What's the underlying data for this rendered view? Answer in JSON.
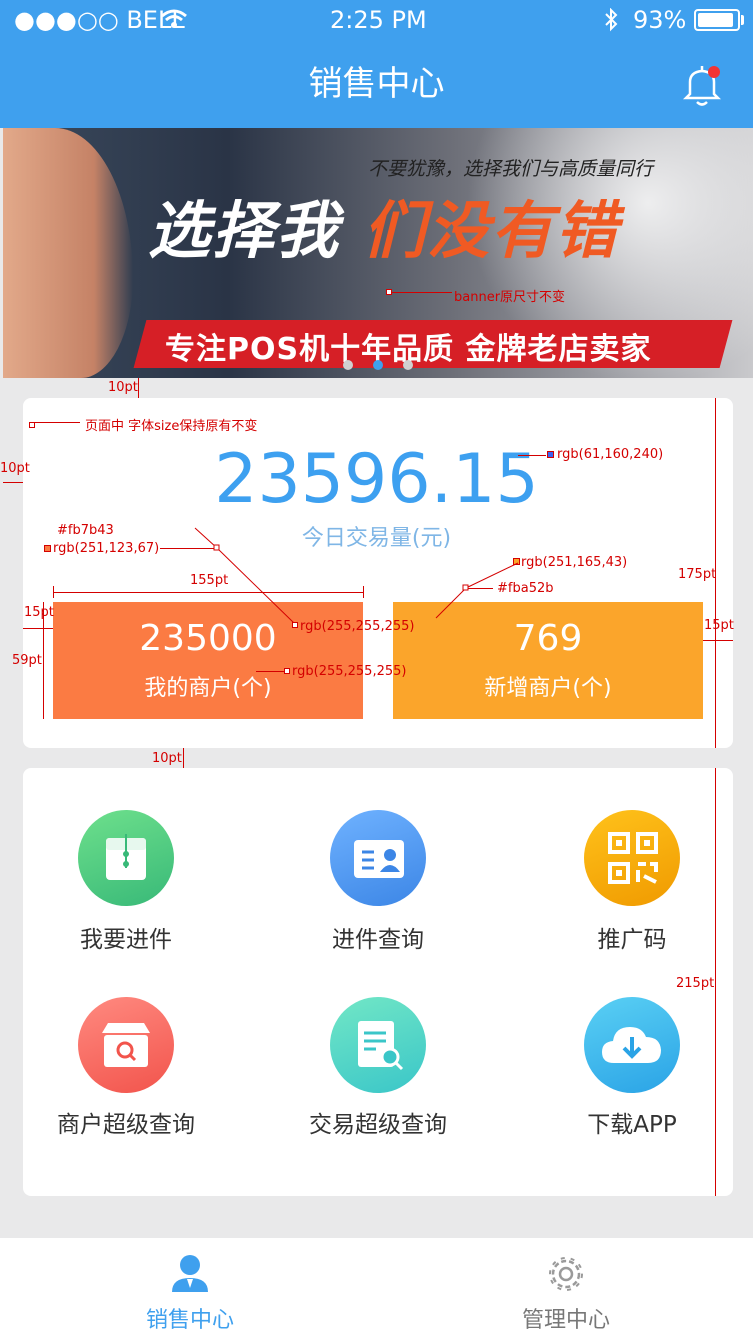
{
  "status_bar": {
    "carrier": "●●●○○ BELL",
    "time": "2:25 PM",
    "battery_pct": "93%",
    "battery_level": 0.93
  },
  "header": {
    "title": "销售中心",
    "bell_icon": "bell-icon",
    "has_notification_dot": true
  },
  "banner": {
    "subtitle": "不要犹豫，选择我们与高质量同行",
    "headline_white": "选择我",
    "headline_orange": "们没有错",
    "strip_text": "专注POS机十年品质 金牌老店卖家",
    "dots": 3,
    "active_dot": 2
  },
  "summary": {
    "amount": "23596.15",
    "amount_label": "今日交易量(元)",
    "tiles": [
      {
        "value": "235000",
        "label": "我的商户(个)",
        "color": "#fb7b43"
      },
      {
        "value": "769",
        "label": "新增商户(个)",
        "color": "#fba52b"
      }
    ]
  },
  "menu": [
    {
      "label": "我要进件",
      "icon": "file-envelope-icon"
    },
    {
      "label": "进件查询",
      "icon": "id-card-icon"
    },
    {
      "label": "推广码",
      "icon": "qr-code-icon"
    },
    {
      "label": "商户超级查询",
      "icon": "shop-search-icon"
    },
    {
      "label": "交易超级查询",
      "icon": "document-search-icon"
    },
    {
      "label": "下载APP",
      "icon": "cloud-download-icon"
    }
  ],
  "tabbar": [
    {
      "label": "销售中心",
      "icon": "user-icon",
      "active": true
    },
    {
      "label": "管理中心",
      "icon": "gear-icon",
      "active": false
    }
  ],
  "annotations": {
    "banner_note": "banner原尺寸不变",
    "font_note": "页面中 字体size保持原有不变",
    "amount_color": "rgb(61,160,240)",
    "tile1_hex": "#fb7b43",
    "tile1_rgb": "rgb(251,123,67)",
    "tile2_hex": "#fba52b",
    "tile2_rgb": "rgb(251,165,43)",
    "white1": "rgb(255,255,255)",
    "white2": "rgb(255,255,255)",
    "gap_top": "10pt",
    "left_margin": "10pt",
    "tile_width": "155pt",
    "tile_left": "15pt",
    "tile_height": "59pt",
    "card1_height": "175pt",
    "tile_right": "15pt",
    "gap_middle": "10pt",
    "card2_height": "215pt"
  },
  "colors": {
    "primary": "#3fa0ee",
    "tile_orange": "#fb7b43",
    "tile_amber": "#fba52b",
    "amount_blue": "#3da0f0"
  }
}
